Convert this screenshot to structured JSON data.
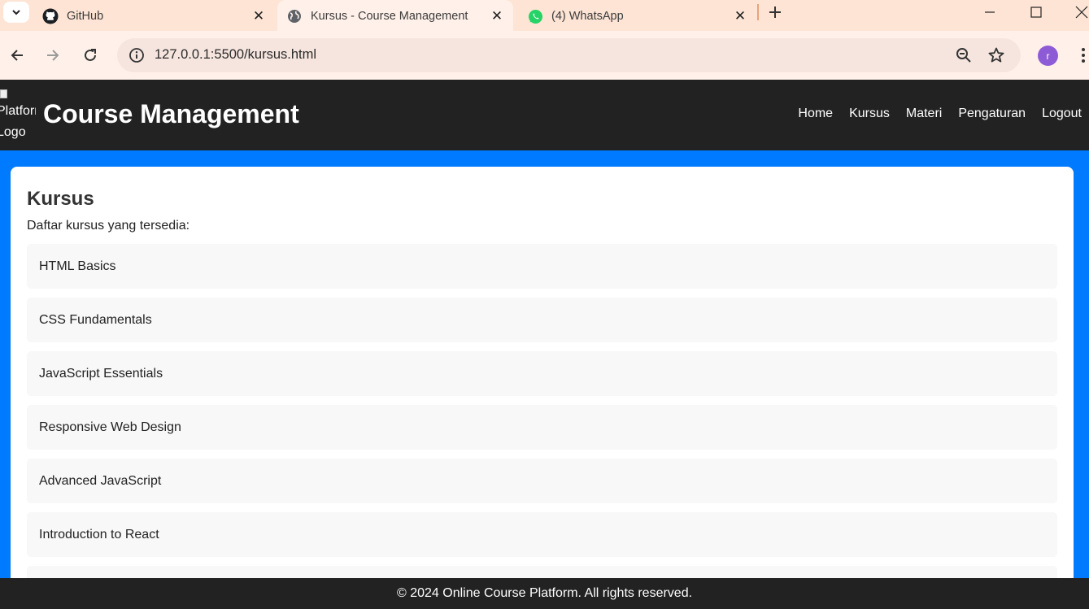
{
  "browser": {
    "tabs": [
      {
        "title": "GitHub",
        "icon": "github-icon"
      },
      {
        "title": "Kursus - Course Management",
        "icon": "globe-icon",
        "active": true
      },
      {
        "title": "(4) WhatsApp",
        "icon": "whatsapp-icon"
      }
    ],
    "url": "127.0.0.1:5500/kursus.html",
    "profile_initial": "r",
    "colors": {
      "tabstrip": "#fde4d4",
      "toolbar": "#fff1ea",
      "profile": "#8e5bd6"
    }
  },
  "header": {
    "logo_alt": "Platform Logo",
    "title": "Course Management",
    "nav": [
      "Home",
      "Kursus",
      "Materi",
      "Pengaturan",
      "Logout"
    ]
  },
  "main": {
    "heading": "Kursus",
    "subtitle": "Daftar kursus yang tersedia:",
    "courses": [
      "HTML Basics",
      "CSS Fundamentals",
      "JavaScript Essentials",
      "Responsive Web Design",
      "Advanced JavaScript",
      "Introduction to React",
      ""
    ]
  },
  "footer": {
    "text": "© 2024 Online Course Platform. All rights reserved."
  },
  "colors": {
    "page_bg": "#007bff",
    "header_bg": "#222222",
    "card_bg": "#ffffff",
    "item_bg": "#f8f8f8"
  }
}
